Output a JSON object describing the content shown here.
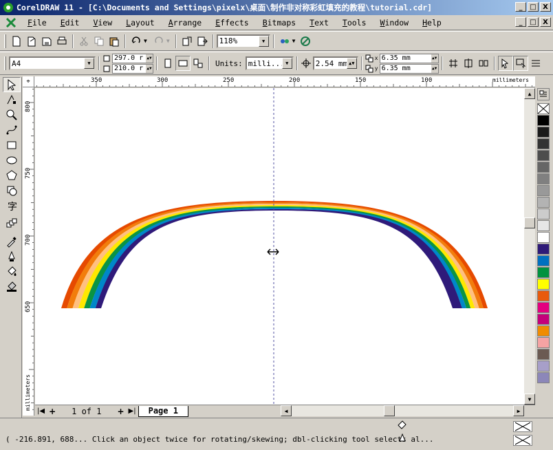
{
  "window": {
    "title": "CorelDRAW 11 - [C:\\Documents and Settings\\pixelx\\桌面\\制作非对称彩虹填充的教程\\tutorial.cdr]",
    "min_label": "_",
    "max_label": "□",
    "close_label": "X"
  },
  "menu": {
    "items": [
      {
        "ul": "F",
        "rest": "ile"
      },
      {
        "ul": "E",
        "rest": "dit"
      },
      {
        "ul": "V",
        "rest": "iew"
      },
      {
        "ul": "L",
        "rest": "ayout"
      },
      {
        "ul": "A",
        "rest": "rrange"
      },
      {
        "ul": "E",
        "rest": "ffects"
      },
      {
        "ul": "B",
        "rest": "itmaps"
      },
      {
        "ul": "T",
        "rest": "ext"
      },
      {
        "ul": "T",
        "rest": "ools"
      },
      {
        "ul": "W",
        "rest": "indow"
      },
      {
        "ul": "H",
        "rest": "elp"
      }
    ]
  },
  "toolbar": {
    "zoom_value": "118%"
  },
  "property_bar": {
    "paper_size": "A4",
    "width": "297.0 r",
    "height": "210.0 r",
    "units_label": "Units:",
    "units_value": "milli...",
    "nudge": "2.54 mm",
    "dup_x": "6.35 mm",
    "dup_y": "6.35 mm",
    "dup_x_label": "x",
    "dup_y_label": "y"
  },
  "ruler": {
    "top_ticks": [
      "350",
      "300",
      "250",
      "200",
      "150",
      "100"
    ],
    "top_unit": "millimeters",
    "left_ticks": [
      "800",
      "750",
      "700",
      "650"
    ],
    "left_unit": "millimeters"
  },
  "page_nav": {
    "first": "|◀",
    "add_before": "+",
    "count": "1 of 1",
    "add_after": "+",
    "last": "▶|",
    "tab": "Page 1"
  },
  "status": {
    "text": "( -216.891, 688... Click an object twice for rotating/skewing; dbl-clicking tool selects al..."
  },
  "palette": {
    "colors": [
      "#000000",
      "#1a1a1a",
      "#333333",
      "#4d4d4d",
      "#666666",
      "#808080",
      "#999999",
      "#b3b3b3",
      "#cccccc",
      "#e6e6e6",
      "#ffffff",
      "#2e1a78",
      "#0070c0",
      "#00923f",
      "#ffff00",
      "#e85a0c",
      "#e3007f",
      "#c5007a",
      "#f08c00",
      "#f5a3a3",
      "#6b5a52",
      "#a79fc9",
      "#8c87b9"
    ]
  },
  "rainbow": {
    "colors": [
      "#e64a00",
      "#f27d0c",
      "#ffc080",
      "#ffe800",
      "#0a9444",
      "#0087c9",
      "#2f1a7a"
    ]
  }
}
